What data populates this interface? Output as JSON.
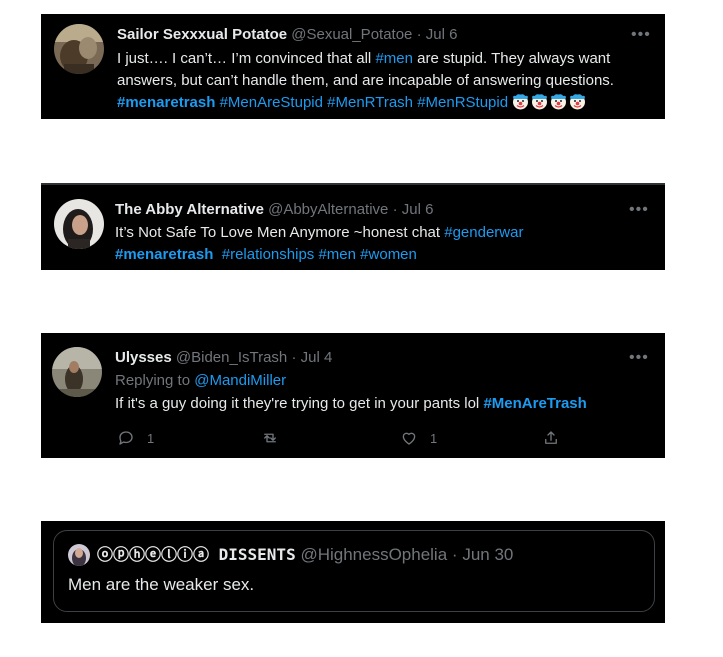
{
  "tweets": [
    {
      "name": "Sailor Sexxxual Potatoe",
      "handle": "@Sexual_Potatoe",
      "dot": "·",
      "date": "Jul 6",
      "more_icon": "more-dots-icon",
      "text_1": "I just…. I can’t… I’m convinced that all ",
      "tag_men": "#men",
      "text_2": " are stupid. They always want answers, but can’t handle them, and are incapable of answering questions.",
      "tags": [
        "#menaretrash",
        "#MenAreStupid",
        "#MenRTrash",
        "#MenRStupid"
      ],
      "emoji": [
        "clown-face-icon",
        "clown-face-icon",
        "clown-face-icon",
        "clown-face-icon"
      ]
    },
    {
      "name": "The Abby Alternative",
      "handle": "@AbbyAlternative",
      "dot": "·",
      "date": "Jul 6",
      "text_1": "It’s Not Safe To Love Men Anymore ~honest chat ",
      "tag_1": "#genderwar",
      "tag_2": "#menaretrash",
      "tag_3": "#relationships",
      "tag_4": "#men",
      "tag_5": "#women"
    },
    {
      "name": "Ulysses",
      "handle": "@Biden_IsTrash",
      "dot": "·",
      "date": "Jul 4",
      "replying_label": "Replying to ",
      "replying_to": "@MandiMiller",
      "text": "If it's a guy doing it they're trying to get in your pants lol ",
      "tag": "#MenAreTrash",
      "actions": {
        "reply_count": "1",
        "retweet_count": "",
        "like_count": "1",
        "share_count": ""
      }
    },
    {
      "name": "ⓞⓟⓗⓔⓛⓘⓐ DISSENTS",
      "handle": "@HighnessOphelia",
      "dot": "·",
      "date": "Jun 30",
      "text": "Men are the weaker sex."
    }
  ],
  "colors": {
    "background": "#000000",
    "text": "#e7e9ea",
    "muted": "#71767b",
    "link": "#1d9bf0"
  }
}
